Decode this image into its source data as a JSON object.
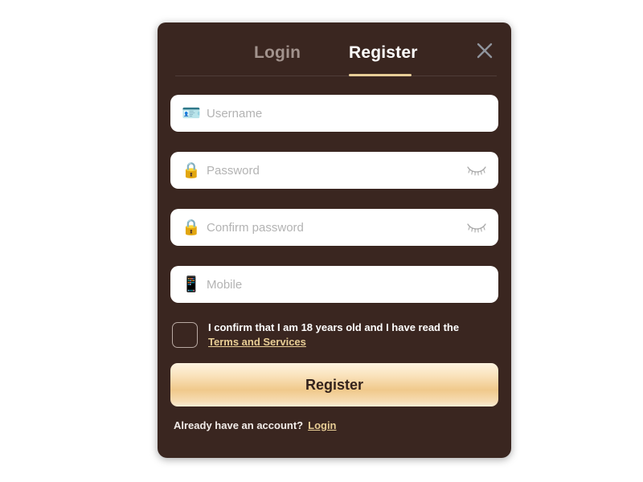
{
  "theme": {
    "page_background": "#ffffff",
    "card_background": "#3a2620",
    "accent_gold": "#e8cd95",
    "active_tab_color": "#ffffff",
    "inactive_tab_color": "#a2938d",
    "field_background": "#ffffff",
    "placeholder_color": "#b3b3b3",
    "close_icon_color": "#8f949c",
    "button_text_color": "#33221c"
  },
  "header": {
    "tabs": [
      {
        "label": "Login",
        "active": false,
        "name": "tab-login"
      },
      {
        "label": "Register",
        "active": true,
        "name": "tab-register"
      }
    ],
    "close_icon": "close-icon"
  },
  "form": {
    "fields": [
      {
        "name": "username",
        "placeholder": "Username",
        "value": "",
        "icon": "id-card-icon",
        "icon_glyph": "🪪",
        "has_visibility_toggle": false
      },
      {
        "name": "password",
        "placeholder": "Password",
        "value": "",
        "icon": "lock-icon",
        "icon_glyph": "🔒",
        "has_visibility_toggle": true,
        "visibility_icon": "eye-closed-icon"
      },
      {
        "name": "confirm-password",
        "placeholder": "Confirm password",
        "value": "",
        "icon": "lock-icon",
        "icon_glyph": "🔒",
        "has_visibility_toggle": true,
        "visibility_icon": "eye-closed-icon"
      },
      {
        "name": "mobile",
        "placeholder": "Mobile",
        "value": "",
        "icon": "mobile-phone-icon",
        "icon_glyph": "📱",
        "has_visibility_toggle": false
      }
    ],
    "consent": {
      "checked": false,
      "text": "I confirm that I am 18 years old and I have read the",
      "link_label": "Terms and Services"
    },
    "submit_label": "Register"
  },
  "footer": {
    "text": "Already have an account?",
    "link_label": "Login"
  }
}
